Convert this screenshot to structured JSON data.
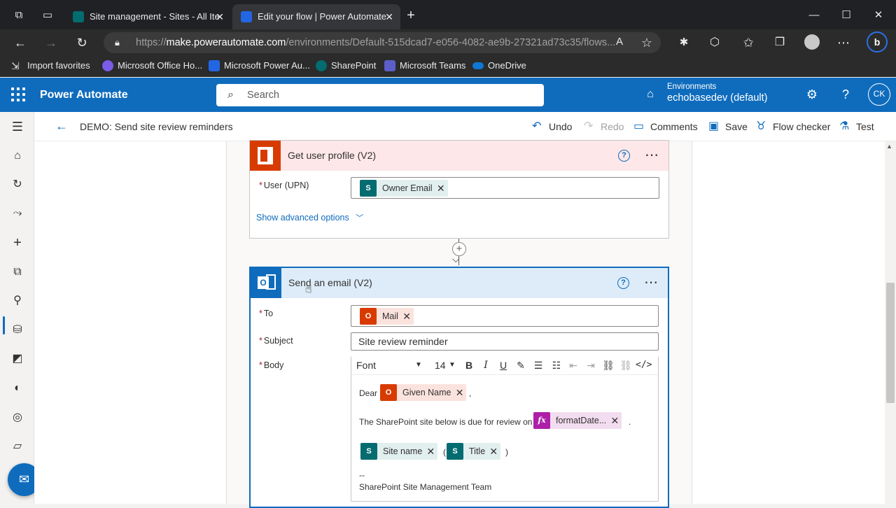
{
  "browser": {
    "tabs": [
      {
        "title": "Site management - Sites - All Ite",
        "active": false
      },
      {
        "title": "Edit your flow | Power Automate",
        "active": true
      }
    ],
    "url_prefix": "https://",
    "url_host": "make.powerautomate.com",
    "url_path": "/environments/Default-515dcad7-e056-4082-ae9b-27321ad73c35/flows...",
    "bookmarks": [
      "Import favorites",
      "Microsoft Office Ho...",
      "Microsoft Power Au...",
      "SharePoint",
      "Microsoft Teams",
      "OneDrive"
    ]
  },
  "header": {
    "brand": "Power Automate",
    "search_placeholder": "Search",
    "env_label": "Environments",
    "env_name": "echobasedev (default)",
    "avatar_initials": "CK"
  },
  "commandbar": {
    "flow_title": "DEMO: Send site review reminders",
    "undo": "Undo",
    "redo": "Redo",
    "comments": "Comments",
    "save": "Save",
    "flow_checker": "Flow checker",
    "test": "Test"
  },
  "card_profile": {
    "title": "Get user profile (V2)",
    "user_label": "User (UPN)",
    "user_token": "Owner Email",
    "advanced": "Show advanced options"
  },
  "card_email": {
    "title": "Send an email (V2)",
    "to_label": "To",
    "to_token": "Mail",
    "subject_label": "Subject",
    "subject_value": "Site review reminder",
    "body_label": "Body",
    "font": "Font",
    "font_size": "14",
    "body": {
      "dear": "Dear",
      "given_name": "Given Name",
      "comma": ",",
      "line2": "The SharePoint site below is due for review on",
      "format_date": "formatDate...",
      "period": ".",
      "site_name": "Site name",
      "open_paren": "(",
      "title_token": "Title",
      "close_paren": ")",
      "sig_dash": "--",
      "sig": "SharePoint Site Management Team"
    }
  },
  "colors": {
    "brand_blue": "#0f6cbd",
    "profile_head": "#fde7e9",
    "email_head": "#deecf9",
    "sharepoint": "#036c70",
    "office": "#d83b01",
    "expression": "#ad1fa8"
  }
}
